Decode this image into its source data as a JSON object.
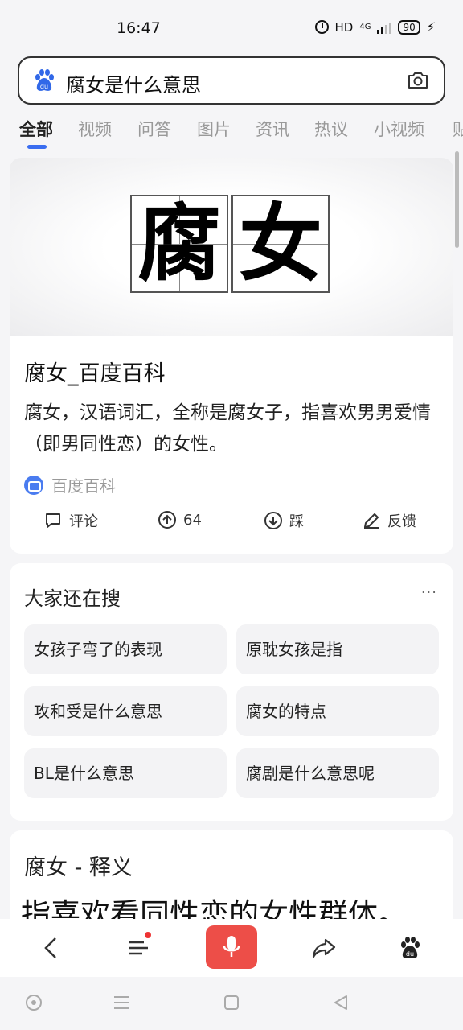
{
  "status_bar": {
    "time": "16:47",
    "hd": "HD",
    "network": "4G",
    "battery": "90"
  },
  "search": {
    "query": "腐女是什么意思",
    "logo_icon": "baidu-paw-icon",
    "camera_icon": "camera-icon"
  },
  "tabs": [
    "全部",
    "视频",
    "问答",
    "图片",
    "资讯",
    "热议",
    "小视频",
    "贴"
  ],
  "active_tab": "全部",
  "baike_card": {
    "chars": [
      "腐",
      "女"
    ],
    "title": "腐女_百度百科",
    "description": "腐女，汉语词汇，全称是腐女子，指喜欢男男爱情（即男同性恋）的女性。",
    "source": "百度百科",
    "actions": {
      "comment": "评论",
      "upvote": "64",
      "downvote": "踩",
      "feedback": "反馈"
    }
  },
  "related": {
    "title": "大家还在搜",
    "more": "···",
    "items": [
      "女孩子弯了的表现",
      "原耽女孩是指",
      "攻和受是什么意思",
      "腐女的特点",
      "BL是什么意思",
      "腐剧是什么意思呢"
    ]
  },
  "definition_card": {
    "title": "腐女 - 释义",
    "text": "指喜欢看同性恋的女性群体。"
  },
  "colors": {
    "accent": "#3a6df0",
    "mic": "#ed4e48"
  }
}
